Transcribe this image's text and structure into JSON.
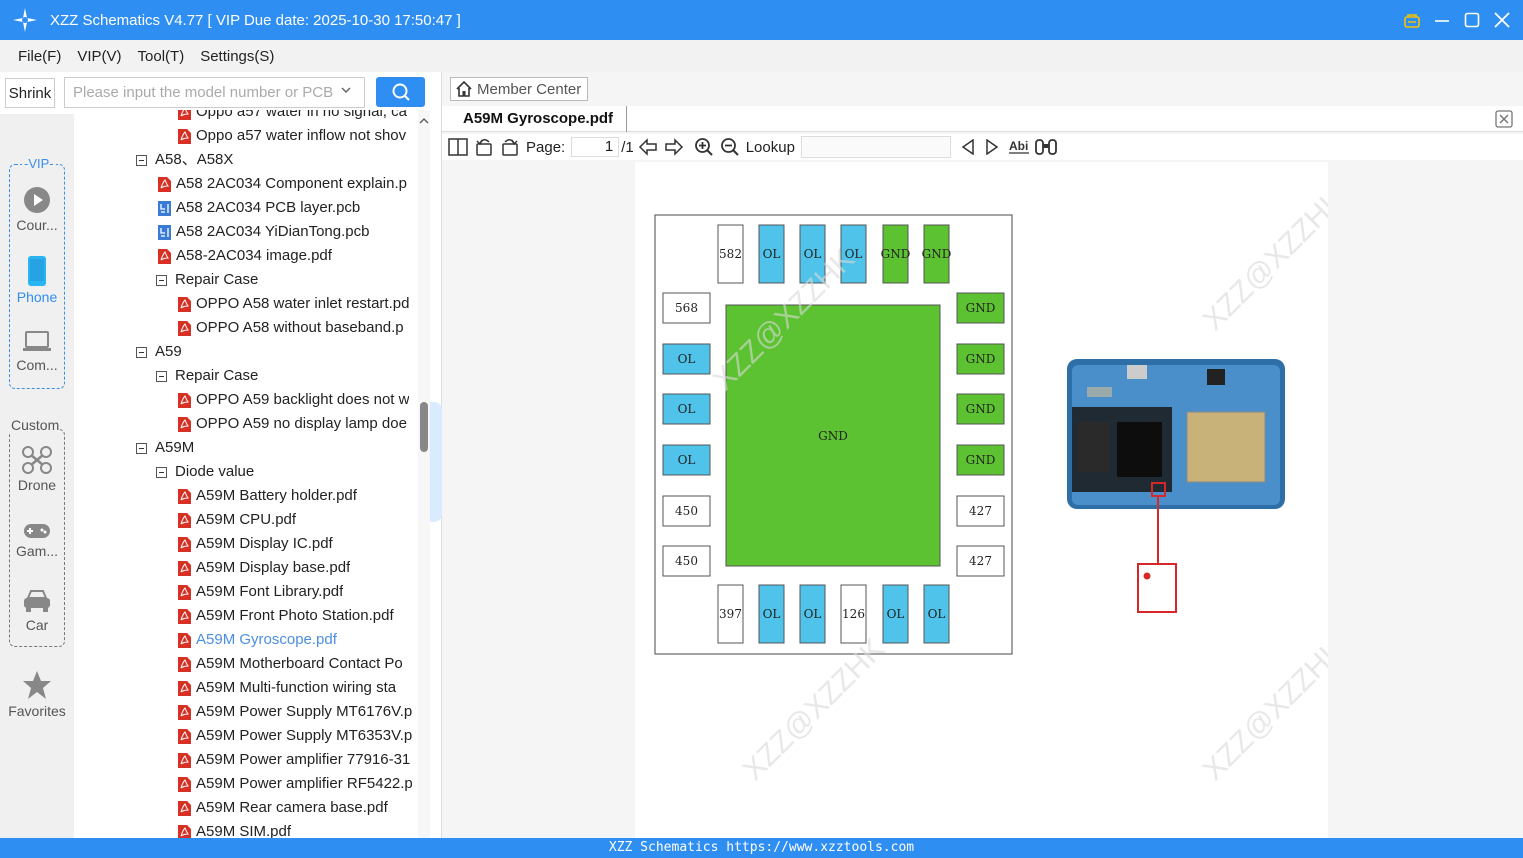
{
  "window": {
    "title": "XZZ Schematics V4.77 [ VIP Due date: 2025-10-30 17:50:47 ]"
  },
  "menu": [
    "File(F)",
    "VIP(V)",
    "Tool(T)",
    "Settings(S)"
  ],
  "search": {
    "shrink_label": "Shrink",
    "placeholder": "Please input the model number or PCB"
  },
  "rail": {
    "vip_label": "-VIP-",
    "custom_label": "Custom",
    "vip_items": [
      "Cour...",
      "Phone",
      "Com..."
    ],
    "custom_items": [
      "Drone",
      "Gam...",
      "Car"
    ],
    "favorites": "Favorites"
  },
  "tree": [
    {
      "label": "Oppo a57 water in no signal, ca",
      "type": "pdf",
      "level": 2
    },
    {
      "label": "Oppo a57 water inflow not shov",
      "type": "pdf",
      "level": 2
    },
    {
      "label": "A58、A58X",
      "type": "folder",
      "level": 1
    },
    {
      "label": "A58 2AC034 Component explain.p",
      "type": "pdf",
      "level": 1
    },
    {
      "label": "A58 2AC034 PCB layer.pcb",
      "type": "pcb",
      "level": 1
    },
    {
      "label": "A58 2AC034 YiDianTong.pcb",
      "type": "pcb",
      "level": 1
    },
    {
      "label": "A58-2AC034 image.pdf",
      "type": "pdf",
      "level": 1
    },
    {
      "label": "Repair Case",
      "type": "folder",
      "level": 2
    },
    {
      "label": "OPPO A58 water inlet restart.pd",
      "type": "pdf",
      "level": 2
    },
    {
      "label": "OPPO A58 without baseband.p",
      "type": "pdf",
      "level": 2
    },
    {
      "label": "A59",
      "type": "folder",
      "level": 1
    },
    {
      "label": "Repair Case",
      "type": "folder",
      "level": 2
    },
    {
      "label": "OPPO A59 backlight does not w",
      "type": "pdf",
      "level": 2
    },
    {
      "label": "OPPO A59 no display lamp doe",
      "type": "pdf",
      "level": 2
    },
    {
      "label": "A59M",
      "type": "folder",
      "level": 1
    },
    {
      "label": "Diode value",
      "type": "folder",
      "level": 2
    },
    {
      "label": "A59M Battery holder.pdf",
      "type": "pdf",
      "level": 2
    },
    {
      "label": "A59M CPU.pdf",
      "type": "pdf",
      "level": 2
    },
    {
      "label": "A59M Display IC.pdf",
      "type": "pdf",
      "level": 2
    },
    {
      "label": "A59M Display base.pdf",
      "type": "pdf",
      "level": 2
    },
    {
      "label": "A59M Font Library.pdf",
      "type": "pdf",
      "level": 2
    },
    {
      "label": "A59M Front Photo Station.pdf",
      "type": "pdf",
      "level": 2
    },
    {
      "label": "A59M Gyroscope.pdf",
      "type": "pdf",
      "level": 2,
      "selected": true
    },
    {
      "label": "A59M Motherboard Contact Po",
      "type": "pdf",
      "level": 2
    },
    {
      "label": "A59M Multi-function wiring sta",
      "type": "pdf",
      "level": 2
    },
    {
      "label": "A59M Power Supply MT6176V.p",
      "type": "pdf",
      "level": 2
    },
    {
      "label": "A59M Power Supply MT6353V.p",
      "type": "pdf",
      "level": 2
    },
    {
      "label": "A59M Power amplifier 77916-31",
      "type": "pdf",
      "level": 2
    },
    {
      "label": "A59M Power amplifier RF5422.p",
      "type": "pdf",
      "level": 2
    },
    {
      "label": "A59M Rear camera base.pdf",
      "type": "pdf",
      "level": 2
    },
    {
      "label": "A59M SIM.pdf",
      "type": "pdf",
      "level": 2
    }
  ],
  "viewer": {
    "member_center": "Member Center",
    "tab_title": "A59M Gyroscope.pdf",
    "page_label": "Page:",
    "page_value": "1",
    "page_total": "/1",
    "lookup_label": "Lookup"
  },
  "schematic": {
    "center_label": "GND",
    "top_pins": [
      "582",
      "OL",
      "OL",
      "OL",
      "GND",
      "GND"
    ],
    "bottom_pins": [
      "397",
      "OL",
      "OL",
      "126",
      "OL",
      "OL"
    ],
    "left_pins": [
      "568",
      "OL",
      "OL",
      "OL",
      "450",
      "450"
    ],
    "right_pins": [
      "GND",
      "GND",
      "GND",
      "GND",
      "427",
      "427"
    ],
    "watermark": "XZZ@XZZHK"
  },
  "colors": {
    "accent": "#2e8ef2",
    "pin_ol": "#4fc3ea",
    "pin_gnd": "#5cc231",
    "selected_text": "#4b8fe0",
    "pdf_icon": "#d93025"
  },
  "footer": "XZZ Schematics https://www.xzztools.com"
}
